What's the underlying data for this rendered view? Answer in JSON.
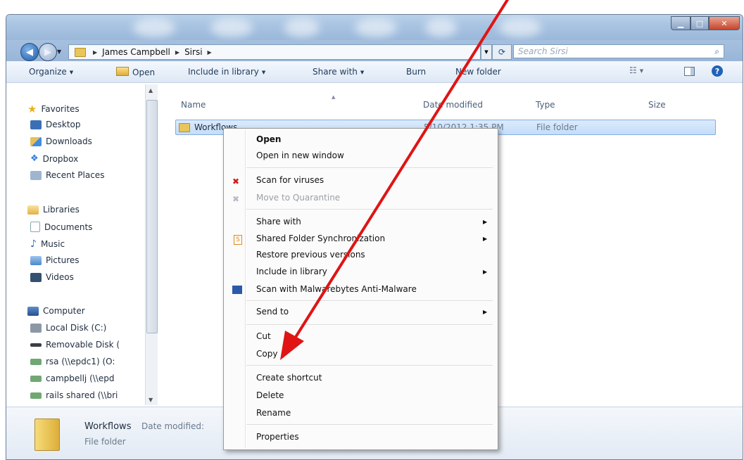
{
  "address": {
    "crumbs": [
      "James Campbell",
      "Sirsi"
    ],
    "search_placeholder": "Search Sirsi"
  },
  "toolbar": {
    "organize": "Organize",
    "open": "Open",
    "include_in_library": "Include in library",
    "share_with": "Share with",
    "burn": "Burn",
    "new_folder": "New folder"
  },
  "navigation": {
    "favorites": {
      "label": "Favorites",
      "items": [
        "Desktop",
        "Downloads",
        "Dropbox",
        "Recent Places"
      ]
    },
    "libraries": {
      "label": "Libraries",
      "items": [
        "Documents",
        "Music",
        "Pictures",
        "Videos"
      ]
    },
    "computer": {
      "label": "Computer",
      "items": [
        "Local Disk (C:)",
        "Removable Disk (",
        "rsa (\\\\epdc1) (O:",
        "campbellj (\\\\epd",
        "rails shared (\\\\bri"
      ]
    }
  },
  "columns": [
    "Name",
    "Date modified",
    "Type",
    "Size"
  ],
  "files": [
    {
      "name": "Workflows",
      "date": "5/10/2012 1:35 PM",
      "type": "File folder"
    }
  ],
  "details": {
    "name": "Workflows",
    "date_label": "Date modified:",
    "type": "File folder"
  },
  "context_menu": [
    "Open",
    "Open in new window",
    "Scan for viruses",
    "Move to Quarantine",
    "Share with",
    "Shared Folder Synchronization",
    "Restore previous versions",
    "Include in library",
    "Scan with Malwarebytes Anti-Malware",
    "Send to",
    "Cut",
    "Copy",
    "Create shortcut",
    "Delete",
    "Rename",
    "Properties"
  ],
  "annotation": {
    "color": "#e01414"
  }
}
